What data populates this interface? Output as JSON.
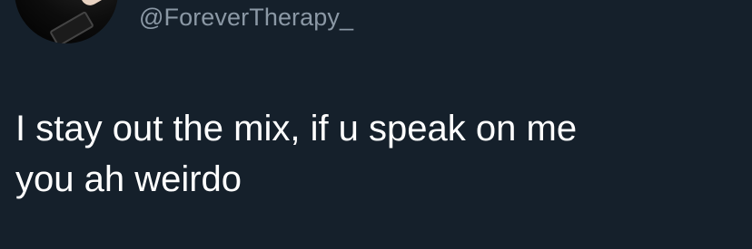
{
  "tweet": {
    "author_handle": "@ForeverTherapy_",
    "text_lines": [
      "I stay out the mix, if u speak on me",
      "you ah weirdo"
    ]
  },
  "colors": {
    "background": "#15202b",
    "text": "#ffffff",
    "handle": "#8b98a5"
  }
}
